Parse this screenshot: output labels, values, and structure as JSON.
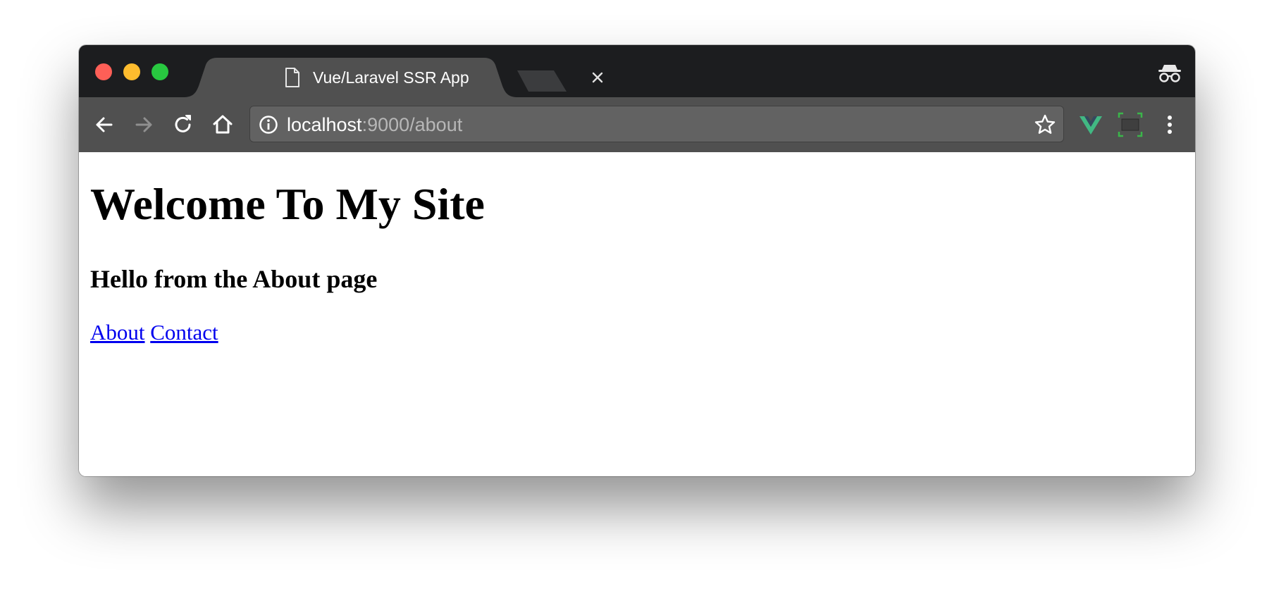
{
  "browser": {
    "tab": {
      "title": "Vue/Laravel SSR App",
      "icon": "page-icon"
    },
    "toolbar": {
      "back_icon": "back-arrow-icon",
      "forward_icon": "forward-arrow-icon",
      "reload_icon": "reload-icon",
      "home_icon": "home-icon"
    },
    "address": {
      "host": "localhost",
      "rest": ":9000/about"
    },
    "extensions": [
      "vue-devtools-icon",
      "screen-capture-icon"
    ],
    "colors": {
      "tabstrip": "#1c1d1f",
      "active_tab": "#505050",
      "toolbar": "#505050",
      "omnibox": "#626262",
      "vue_green": "#41b883",
      "link": "#0000ee"
    }
  },
  "page": {
    "heading": "Welcome To My Site",
    "subheading": "Hello from the About page",
    "links": [
      {
        "label": "About"
      },
      {
        "label": "Contact"
      }
    ]
  }
}
